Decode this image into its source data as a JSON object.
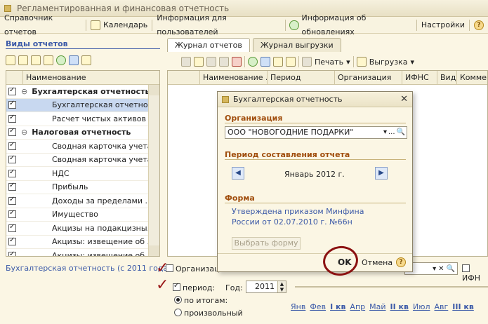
{
  "window": {
    "title": "Регламентированная и финансовая отчетность"
  },
  "toolbar": {
    "items": [
      "Справочник отчетов",
      "Календарь",
      "Информация для пользователей",
      "Информация об обновлениях",
      "Настройки"
    ]
  },
  "left_panel": {
    "title": "Виды отчетов",
    "column": "Наименование",
    "rows": [
      {
        "label": "Бухгалтерская отчетность",
        "group": true
      },
      {
        "label": "Бухгалтерская отчетнос...",
        "selected": true
      },
      {
        "label": "Расчет чистых активов"
      },
      {
        "label": "Налоговая отчетность",
        "group": true
      },
      {
        "label": "Сводная карточка учета..."
      },
      {
        "label": "Сводная карточка учета..."
      },
      {
        "label": "НДС"
      },
      {
        "label": "Прибыль"
      },
      {
        "label": "Доходы за пределами ..."
      },
      {
        "label": "Имущество"
      },
      {
        "label": "Акцизы на подакцизны..."
      },
      {
        "label": "Акцизы: извещение об ..."
      },
      {
        "label": "Акцизы: извещение об ..."
      }
    ]
  },
  "right_panel": {
    "tabs": [
      "Журнал отчетов",
      "Журнал выгрузки"
    ],
    "print_label": "Печать",
    "export_label": "Выгрузка",
    "columns": [
      "Наименование ...",
      "Период",
      "Организация",
      "ИФНС",
      "Вид",
      "Коммен"
    ]
  },
  "bottom": {
    "link": "Бухгалтерская отчетность (с 2011 года)",
    "org_label": "Организаци",
    "ifns_label": "ИФН",
    "period_label": "период:",
    "year_label": "Год:",
    "year_value": "2011",
    "radio_totals": "по итогам:",
    "radio_custom": "произвольный",
    "months": [
      {
        "label": "Янв",
        "bold": false
      },
      {
        "label": "Фев",
        "bold": false
      },
      {
        "label": "I кв",
        "bold": true
      },
      {
        "label": "Апр",
        "bold": false
      },
      {
        "label": "Май",
        "bold": false
      },
      {
        "label": "II кв",
        "bold": true
      },
      {
        "label": "Июл",
        "bold": false
      },
      {
        "label": "Авг",
        "bold": false
      },
      {
        "label": "III кв",
        "bold": true
      }
    ]
  },
  "dialog": {
    "title": "Бухгалтерская отчетность",
    "org_section": "Организация",
    "org_value": "ООО \"НОВОГОДНИЕ ПОДАРКИ\"",
    "period_section": "Период составления отчета",
    "period_value": "Январь 2012 г.",
    "form_section": "Форма",
    "form_text": "Утверждена приказом Минфина России от 02.07.2010 г. №66н",
    "choose_form": "Выбрать форму",
    "ok": "OK",
    "cancel": "Отмена"
  }
}
